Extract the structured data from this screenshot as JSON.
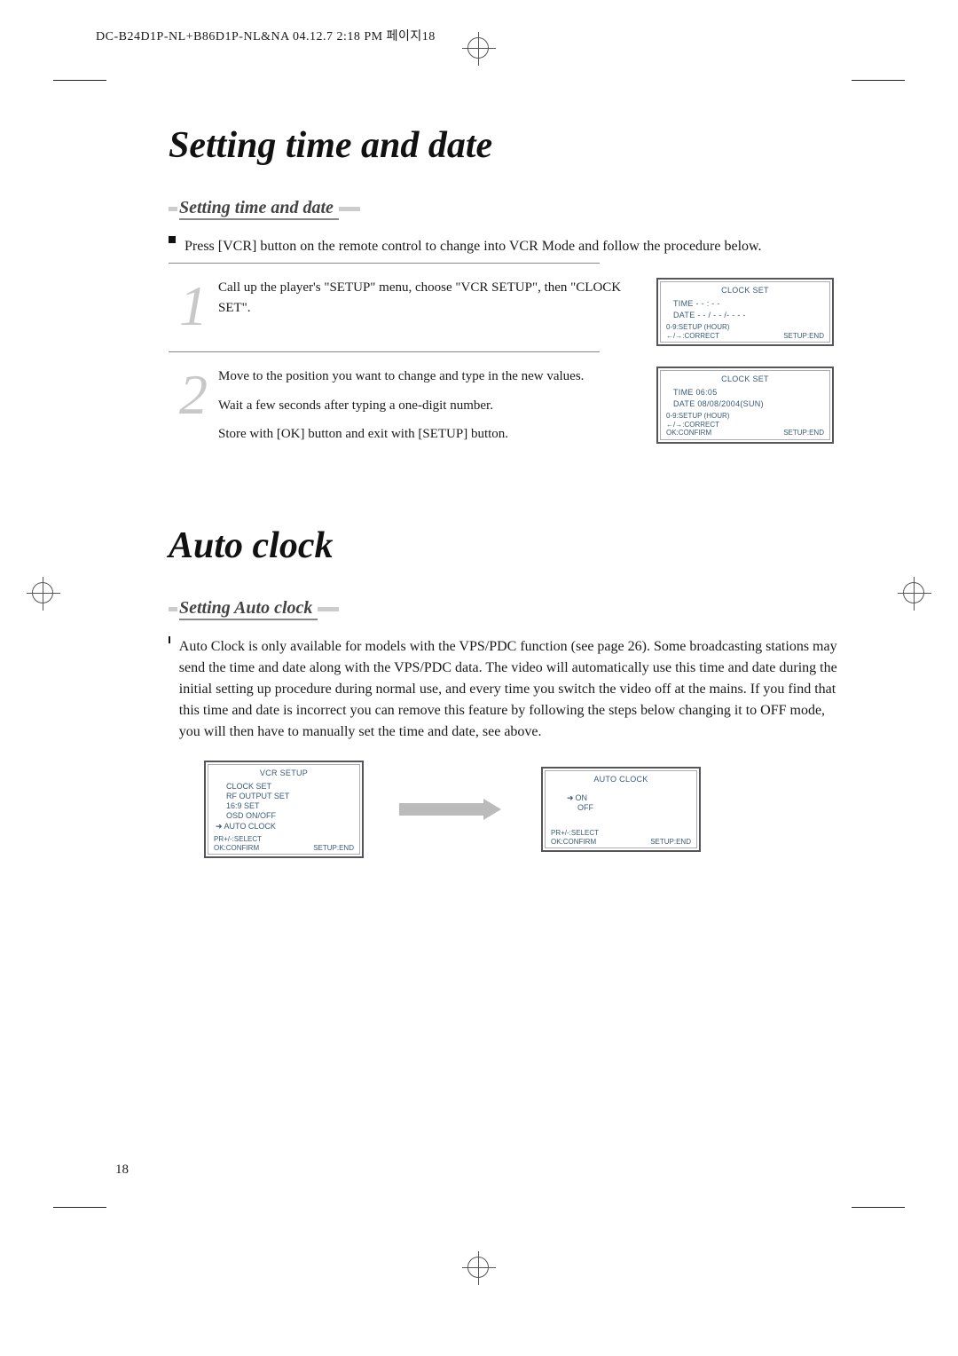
{
  "header": "DC-B24D1P-NL+B86D1P-NL&NA  04.12.7  2:18 PM  페이지18",
  "title1": "Setting time and date",
  "section1": "Setting time and date",
  "intro1": "Press [VCR] button on the remote control to change into VCR Mode and follow the procedure below.",
  "step1_num": "1",
  "step1_text": "Call up the player's \"SETUP\" menu, choose \"VCR SETUP\", then \"CLOCK SET\".",
  "step2_num": "2",
  "step2_p1": "Move to the position you want to change and type in the new values.",
  "step2_p2": "Wait a few seconds after typing a one-digit number.",
  "step2_p3": "Store with [OK] button and exit with [SETUP] button.",
  "osd1": {
    "title": "CLOCK SET",
    "time": "TIME  - - : - -",
    "date": "DATE  - - / - - /- - - -",
    "foot1": "0-9:SETUP (HOUR)",
    "foot2l": "←/→:CORRECT",
    "foot2r": "SETUP:END"
  },
  "osd2": {
    "title": "CLOCK SET",
    "time": "TIME  06:05",
    "date": "DATE  08/08/2004(SUN)",
    "foot1": "0-9:SETUP (HOUR)",
    "foot2": "←/→:CORRECT",
    "foot3l": "OK:CONFIRM",
    "foot3r": "SETUP:END"
  },
  "title2": "Auto clock",
  "section2": "Setting Auto clock",
  "intro2": "Auto Clock is only available for models with the VPS/PDC function (see page 26). Some broadcasting stations may send the time and date along with the VPS/PDC data. The video will automatically use this time and date during the initial setting up procedure during normal use, and every time you switch the video off at the mains. If you find that this time and date is incorrect you can remove this feature by following the steps below changing it to OFF mode, you will then have to manually set the time and date, see above.",
  "osd3": {
    "title": "VCR SETUP",
    "i1": "CLOCK SET",
    "i2": "RF OUTPUT SET",
    "i3": "16:9 SET",
    "i4": "OSD ON/OFF",
    "i5": "AUTO CLOCK",
    "foot1": "PR+/-:SELECT",
    "foot2l": "OK:CONFIRM",
    "foot2r": "SETUP:END"
  },
  "osd4": {
    "title": "AUTO CLOCK",
    "i1": "ON",
    "i2": "OFF",
    "foot1": "PR+/-:SELECT",
    "foot2l": "OK:CONFIRM",
    "foot2r": "SETUP:END"
  },
  "page": "18"
}
